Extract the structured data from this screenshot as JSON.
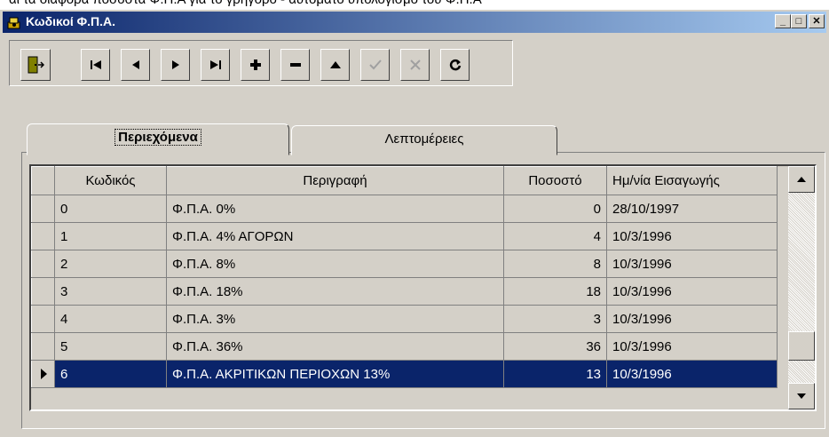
{
  "background_text": "αι τα διάφορα ποσοστά Φ.Π.Α για το γρήγορο - αυτόματο υπολογισμό του Φ.Π.Α",
  "window": {
    "title": "Κωδικοί Φ.Π.Α.",
    "minimize_label": "_",
    "maximize_label": "□",
    "close_label": "✕"
  },
  "toolbar": {
    "exit_icon": "exit-door-icon",
    "buttons": [
      {
        "name": "first-record",
        "icon": "first-icon",
        "enabled": true
      },
      {
        "name": "prior-record",
        "icon": "prior-icon",
        "enabled": true
      },
      {
        "name": "next-record",
        "icon": "next-icon",
        "enabled": true
      },
      {
        "name": "last-record",
        "icon": "last-icon",
        "enabled": true
      },
      {
        "name": "insert-record",
        "icon": "plus-icon",
        "enabled": true
      },
      {
        "name": "delete-record",
        "icon": "minus-icon",
        "enabled": true
      },
      {
        "name": "edit-record",
        "icon": "up-triangle-icon",
        "enabled": true
      },
      {
        "name": "post-edit",
        "icon": "check-icon",
        "enabled": false
      },
      {
        "name": "cancel-edit",
        "icon": "x-icon",
        "enabled": false
      },
      {
        "name": "refresh-data",
        "icon": "refresh-icon",
        "enabled": true
      }
    ]
  },
  "tabs": [
    {
      "label": "Περιεχόμενα",
      "active": true
    },
    {
      "label": "Λεπτομέρειες",
      "active": false
    }
  ],
  "grid": {
    "columns": [
      "Κωδικός",
      "Περιγραφή",
      "Ποσοστό",
      "Ημ/νία Εισαγωγής"
    ],
    "rows": [
      {
        "code": "0",
        "description": "Φ.Π.Α. 0%",
        "rate": "0",
        "date": "28/10/1997",
        "selected": false
      },
      {
        "code": "1",
        "description": "Φ.Π.Α. 4% ΑΓΟΡΩΝ",
        "rate": "4",
        "date": "10/3/1996",
        "selected": false
      },
      {
        "code": "2",
        "description": "Φ.Π.Α. 8%",
        "rate": "8",
        "date": "10/3/1996",
        "selected": false
      },
      {
        "code": "3",
        "description": "Φ.Π.Α. 18%",
        "rate": "18",
        "date": "10/3/1996",
        "selected": false
      },
      {
        "code": "4",
        "description": "Φ.Π.Α. 3%",
        "rate": "3",
        "date": "10/3/1996",
        "selected": false
      },
      {
        "code": "5",
        "description": "Φ.Π.Α. 36%",
        "rate": "36",
        "date": "10/3/1996",
        "selected": false
      },
      {
        "code": "6",
        "description": "Φ.Π.Α. ΑΚΡΙΤΙΚΩΝ ΠΕΡΙΟΧΩΝ 13%",
        "rate": "13",
        "date": "10/3/1996",
        "selected": true
      }
    ],
    "scroll_position": 0.86
  }
}
